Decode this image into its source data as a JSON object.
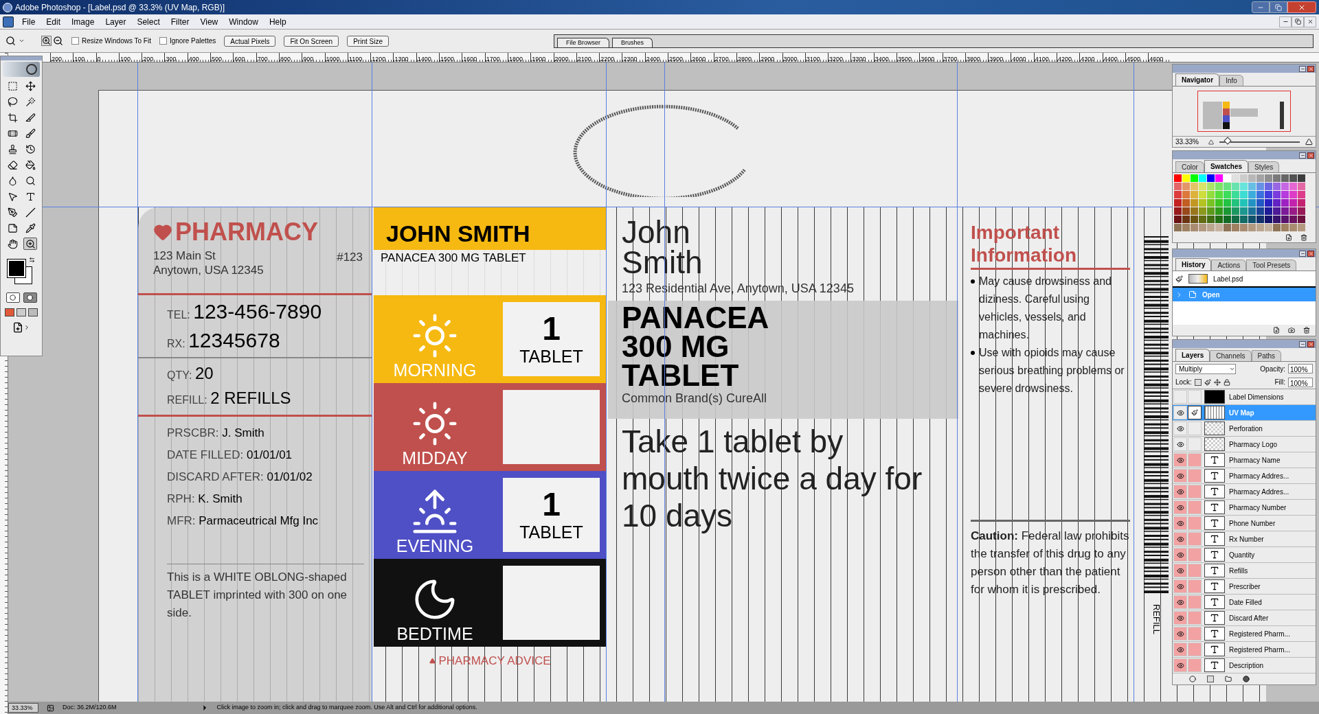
{
  "window": {
    "title": "Adobe Photoshop - [Label.psd @ 33.3% (UV Map, RGB)]"
  },
  "menu": [
    "File",
    "Edit",
    "Image",
    "Layer",
    "Select",
    "Filter",
    "View",
    "Window",
    "Help"
  ],
  "options_bar": {
    "checkboxes": [
      {
        "label": "Resize Windows To Fit",
        "checked": false
      },
      {
        "label": "Ignore Palettes",
        "checked": false
      }
    ],
    "buttons": [
      "Actual Pixels",
      "Fit On Screen",
      "Print Size"
    ],
    "palette_well": [
      "File Browser",
      "Brushes"
    ]
  },
  "ruler_labels": [
    "200",
    "100",
    "0",
    "100",
    "200",
    "300",
    "400",
    "500",
    "600",
    "700",
    "800",
    "900",
    "1000",
    "1100",
    "1200",
    "1300",
    "1400",
    "1500",
    "1600",
    "1700",
    "1800",
    "1900",
    "2000",
    "2100",
    "2200",
    "2300",
    "2400",
    "2500",
    "2600",
    "2700",
    "2800",
    "2900",
    "3000",
    "3100",
    "3200",
    "3300",
    "3400",
    "3500",
    "3600",
    "3700",
    "3800",
    "3900",
    "4000",
    "4100",
    "4200",
    "4300",
    "4400",
    "4500",
    "4600"
  ],
  "tools": [
    {
      "kind": "marquee",
      "selected": false
    },
    {
      "kind": "move",
      "selected": false
    },
    {
      "kind": "lasso",
      "selected": false
    },
    {
      "kind": "wand",
      "selected": false
    },
    {
      "kind": "crop",
      "selected": false
    },
    {
      "kind": "slice",
      "selected": false
    },
    {
      "kind": "heal",
      "selected": false
    },
    {
      "kind": "brush",
      "selected": false
    },
    {
      "kind": "stamp",
      "selected": false
    },
    {
      "kind": "history",
      "selected": false
    },
    {
      "kind": "eraser",
      "selected": false
    },
    {
      "kind": "bucket",
      "selected": false
    },
    {
      "kind": "blur",
      "selected": false
    },
    {
      "kind": "dodge",
      "selected": false
    },
    {
      "kind": "pointer",
      "selected": false
    },
    {
      "kind": "type",
      "selected": false
    },
    {
      "kind": "pen",
      "selected": false
    },
    {
      "kind": "line",
      "selected": false
    },
    {
      "kind": "notes",
      "selected": false
    },
    {
      "kind": "eyedropper",
      "selected": false
    },
    {
      "kind": "hand",
      "selected": false
    },
    {
      "kind": "zoom",
      "selected": true
    }
  ],
  "label": {
    "pharmacy": {
      "name": "PHARMACY",
      "address": [
        "123 Main St",
        "Anytown, USA 12345"
      ],
      "number": "#123",
      "big_fields": [
        {
          "label": "TEL:",
          "value": "123-456-7890"
        },
        {
          "label": "RX:",
          "value": "12345678"
        }
      ],
      "mid_fields": [
        {
          "label": "QTY:",
          "value": "20"
        },
        {
          "label": "REFILL:",
          "value": "2 REFILLS"
        }
      ],
      "small_fields": [
        {
          "label": "PRSCBR:",
          "value": "J. Smith"
        },
        {
          "label": "DATE FILLED:",
          "value": "01/01/01"
        },
        {
          "label": "DISCARD AFTER:",
          "value": "01/01/02"
        },
        {
          "label": "RPH:",
          "value": "K. Smith"
        },
        {
          "label": "MFR:",
          "value": "Parmaceutrical Mfg Inc"
        }
      ],
      "description": "This is a WHITE OBLONG-shaped TABLET imprinted with 300 on one side."
    },
    "schedule": {
      "patient": "JOHN SMITH",
      "drug": "PANACEA 300 MG TABLET",
      "times": [
        {
          "label": "MORNING",
          "kind": "sun",
          "color": "#f6b911",
          "dose": "1",
          "unit": "TABLET"
        },
        {
          "label": "MIDDAY",
          "kind": "sun",
          "color": "#c0504d"
        },
        {
          "label": "EVENING",
          "kind": "sunrise",
          "color": "#4f4fc6",
          "dose": "1",
          "unit": "TABLET"
        },
        {
          "label": "BEDTIME",
          "kind": "moon",
          "color": "#111111"
        }
      ],
      "footer": "PHARMACY ADVICE"
    },
    "main": {
      "patient": [
        "John",
        "Smith"
      ],
      "address": "123 Residential Ave, Anytown, USA 12345",
      "drug": [
        "PANACEA",
        "300 MG",
        "TABLET"
      ],
      "brand": "Common Brand(s) CureAll",
      "directions": "Take 1 tablet by mouth twice a day for 10 days"
    },
    "info": {
      "title": "Important Information",
      "bullets": [
        "May cause drowsiness and diziness. Careful using vehicles, vessels, and machines.",
        "Use with opioids may cause serious breathing problems or severe drowsiness."
      ],
      "caution": "**Caution:** Federal law prohibits the transfer of this drug to any person other than the patient for whom it is prescribed."
    },
    "side_text": "REFILL"
  },
  "navigator": {
    "tabs": [
      {
        "label": "Navigator",
        "selected": true
      },
      {
        "label": "Info",
        "selected": false
      }
    ],
    "zoom": "33.33%",
    "zoom_slider": {
      "level": 0.1
    }
  },
  "swatches": {
    "tabs": [
      {
        "label": "Color",
        "selected": false
      },
      {
        "label": "Swatches",
        "selected": true
      },
      {
        "label": "Styles",
        "selected": false
      }
    ]
  },
  "history": {
    "tabs": [
      {
        "label": "History",
        "selected": true
      },
      {
        "label": "Actions",
        "selected": false
      },
      {
        "label": "Tool Presets",
        "selected": false
      }
    ],
    "items": [
      {
        "label": "Label.psd",
        "kind": "snapshot",
        "selected": false
      },
      {
        "label": "Open",
        "kind": "step",
        "selected": true
      }
    ]
  },
  "layers": {
    "tabs": [
      {
        "label": "Layers",
        "selected": true
      },
      {
        "label": "Channels",
        "selected": false
      },
      {
        "label": "Paths",
        "selected": false
      }
    ],
    "blend_mode": "Multiply",
    "opacity_label": "Opacity:",
    "opacity": "100%",
    "lock_label": "Lock:",
    "fill_label": "Fill:",
    "fill": "100%",
    "items": [
      {
        "name": "Label Dimensions",
        "kind": "dark",
        "visible": false,
        "active": false,
        "red_tag": false,
        "selected": false
      },
      {
        "name": "UV Map",
        "kind": "stripes",
        "visible": true,
        "active": true,
        "red_tag": false,
        "selected": true
      },
      {
        "name": "Perforation",
        "kind": "transparent",
        "visible": true,
        "active": false,
        "red_tag": false,
        "selected": false
      },
      {
        "name": "Pharmacy Logo",
        "kind": "transparent",
        "visible": true,
        "active": false,
        "red_tag": false,
        "selected": false
      },
      {
        "name": "Pharmacy Name",
        "kind": "text",
        "visible": true,
        "active": false,
        "red_tag": true,
        "selected": false
      },
      {
        "name": "Pharmacy Addres...",
        "kind": "text",
        "visible": true,
        "active": false,
        "red_tag": true,
        "selected": false
      },
      {
        "name": "Pharmacy Addres...",
        "kind": "text",
        "visible": true,
        "active": false,
        "red_tag": true,
        "selected": false
      },
      {
        "name": "Pharmacy Number",
        "kind": "text",
        "visible": true,
        "active": false,
        "red_tag": true,
        "selected": false
      },
      {
        "name": "Phone Number",
        "kind": "text",
        "visible": true,
        "active": false,
        "red_tag": true,
        "selected": false
      },
      {
        "name": "Rx Number",
        "kind": "text",
        "visible": true,
        "active": false,
        "red_tag": true,
        "selected": false
      },
      {
        "name": "Quantity",
        "kind": "text",
        "visible": true,
        "active": false,
        "red_tag": true,
        "selected": false
      },
      {
        "name": "Refills",
        "kind": "text",
        "visible": true,
        "active": false,
        "red_tag": true,
        "selected": false
      },
      {
        "name": "Prescriber",
        "kind": "text",
        "visible": true,
        "active": false,
        "red_tag": true,
        "selected": false
      },
      {
        "name": "Date Filled",
        "kind": "text",
        "visible": true,
        "active": false,
        "red_tag": true,
        "selected": false
      },
      {
        "name": "Discard After",
        "kind": "text",
        "visible": true,
        "active": false,
        "red_tag": true,
        "selected": false
      },
      {
        "name": "Registered Pharm...",
        "kind": "text",
        "visible": true,
        "active": false,
        "red_tag": true,
        "selected": false
      },
      {
        "name": "Registered Pharm...",
        "kind": "text",
        "visible": true,
        "active": false,
        "red_tag": true,
        "selected": false
      },
      {
        "name": "Description",
        "kind": "text",
        "visible": true,
        "active": false,
        "red_tag": true,
        "selected": false
      }
    ]
  },
  "status_bar": {
    "zoom": "33.33%",
    "doc": "Doc: 36.2M/120.6M",
    "hint": "Click image to zoom in; click and drag to marquee zoom. Use Alt and Ctrl for additional options."
  }
}
